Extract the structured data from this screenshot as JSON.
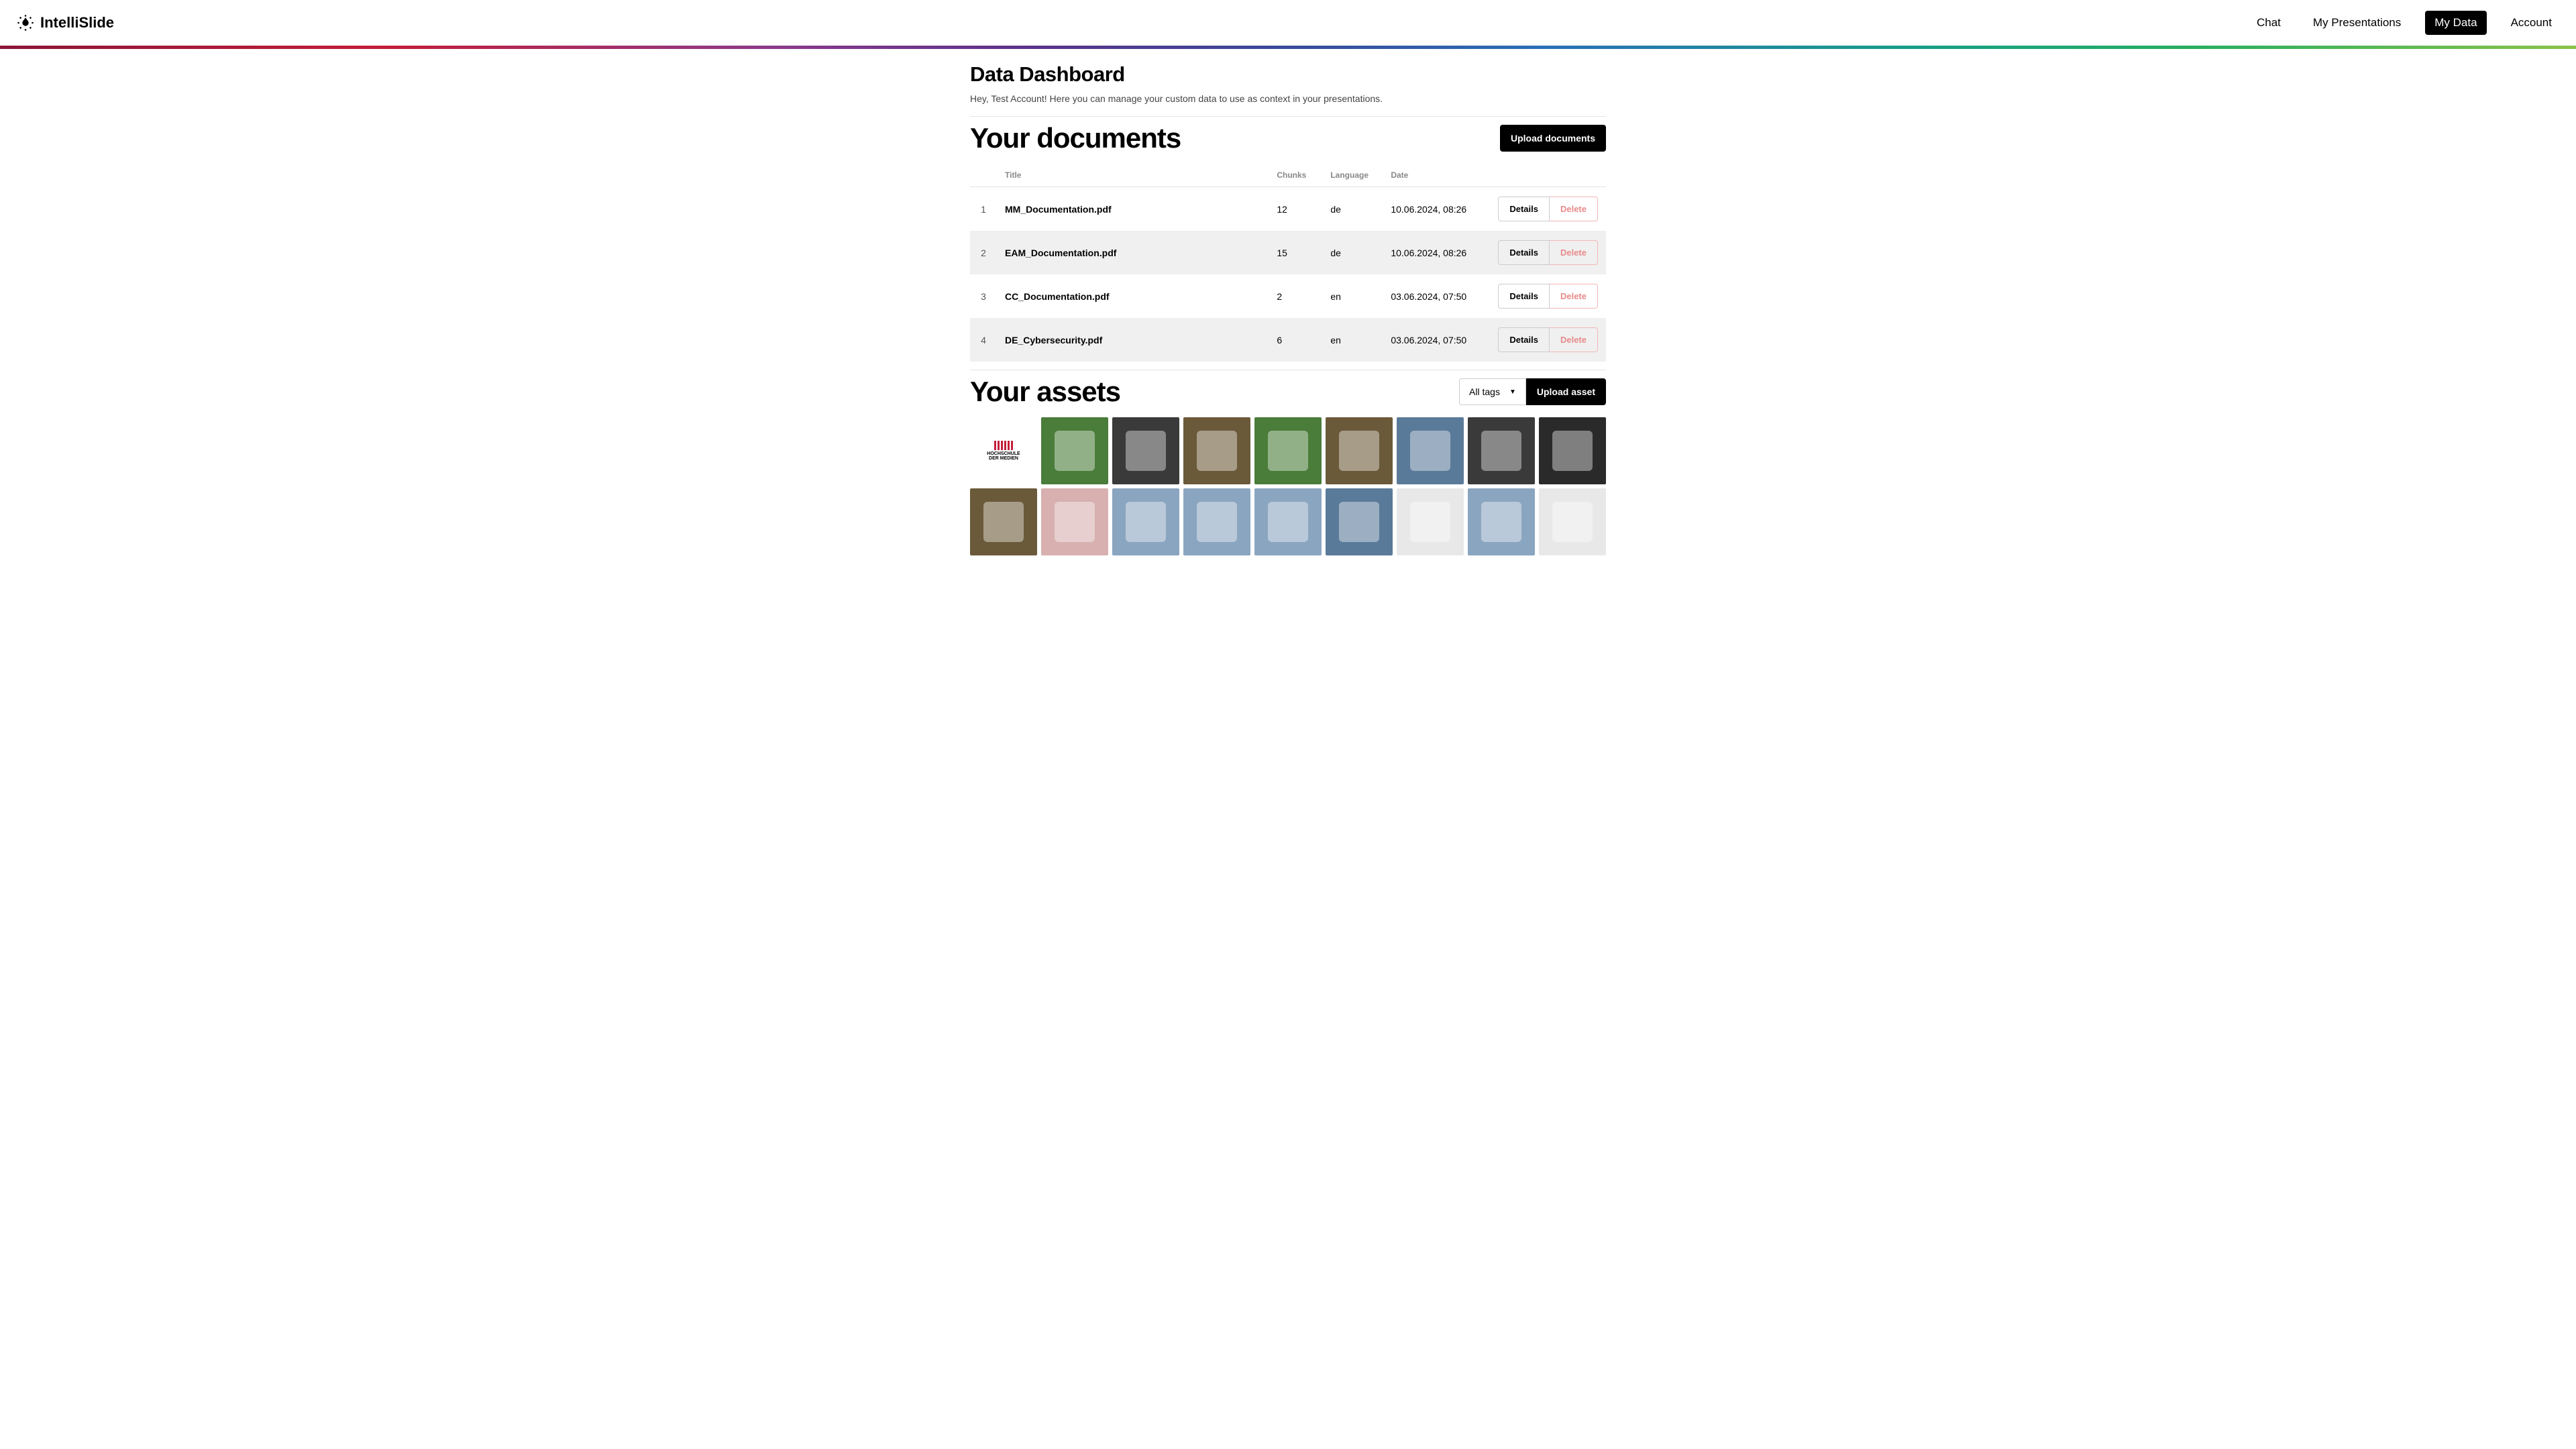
{
  "brand": "IntelliSlide",
  "nav": {
    "links": [
      {
        "label": "Chat",
        "active": false
      },
      {
        "label": "My Presentations",
        "active": false
      },
      {
        "label": "My Data",
        "active": true
      },
      {
        "label": "Account",
        "active": false
      }
    ]
  },
  "dashboard": {
    "title": "Data Dashboard",
    "subtitle": "Hey, Test Account! Here you can manage your custom data to use as context in your presentations."
  },
  "documents": {
    "heading": "Your documents",
    "upload_label": "Upload documents",
    "columns": {
      "idx": "",
      "title": "Title",
      "chunks": "Chunks",
      "language": "Language",
      "date": "Date",
      "actions": ""
    },
    "details_label": "Details",
    "delete_label": "Delete",
    "rows": [
      {
        "idx": "1",
        "title": "MM_Documentation.pdf",
        "chunks": "12",
        "language": "de",
        "date": "10.06.2024, 08:26"
      },
      {
        "idx": "2",
        "title": "EAM_Documentation.pdf",
        "chunks": "15",
        "language": "de",
        "date": "10.06.2024, 08:26"
      },
      {
        "idx": "3",
        "title": "CC_Documentation.pdf",
        "chunks": "2",
        "language": "en",
        "date": "03.06.2024, 07:50"
      },
      {
        "idx": "4",
        "title": "DE_Cybersecurity.pdf",
        "chunks": "6",
        "language": "en",
        "date": "03.06.2024, 07:50"
      }
    ]
  },
  "assets": {
    "heading": "Your assets",
    "tag_filter_label": "All tags",
    "upload_label": "Upload asset",
    "tiles": [
      {
        "kind": "logo"
      },
      {
        "kind": "grass"
      },
      {
        "kind": "indoor"
      },
      {
        "kind": "wood"
      },
      {
        "kind": "grass"
      },
      {
        "kind": "wood"
      },
      {
        "kind": "building2"
      },
      {
        "kind": "indoor"
      },
      {
        "kind": "dark"
      },
      {
        "kind": "wood"
      },
      {
        "kind": "pink"
      },
      {
        "kind": "building"
      },
      {
        "kind": "building"
      },
      {
        "kind": "building"
      },
      {
        "kind": "building2"
      },
      {
        "kind": "light"
      },
      {
        "kind": "building"
      },
      {
        "kind": "light"
      }
    ]
  }
}
